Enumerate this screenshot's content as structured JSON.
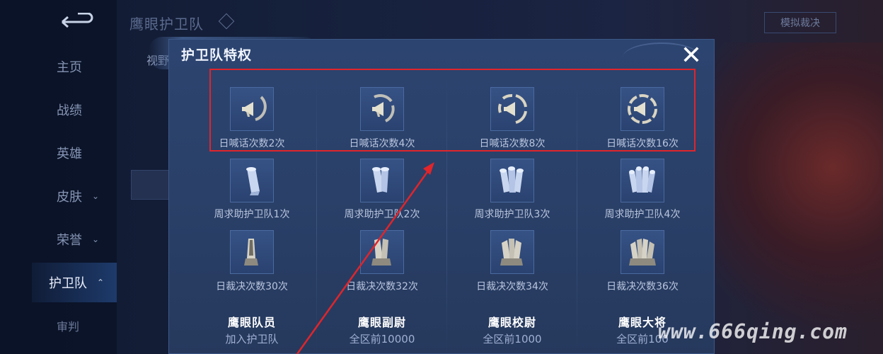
{
  "page": {
    "title": "鹰眼护卫队",
    "sim_button": "模拟裁决",
    "under_tab": "视野"
  },
  "sidebar": {
    "items": [
      {
        "label": "主页",
        "chevron": ""
      },
      {
        "label": "战绩",
        "chevron": ""
      },
      {
        "label": "英雄",
        "chevron": ""
      },
      {
        "label": "皮肤",
        "chevron": "⌄"
      },
      {
        "label": "荣誉",
        "chevron": "⌄"
      },
      {
        "label": "护卫队",
        "chevron": "⌃"
      }
    ],
    "sub_item": "审判"
  },
  "modal": {
    "title": "护卫队特权",
    "close_glyph": "✕",
    "rows": [
      {
        "type": "shout",
        "labels": [
          "日喊话次数2次",
          "日喊话次数4次",
          "日喊话次数8次",
          "日喊话次数16次"
        ]
      },
      {
        "type": "scroll",
        "labels": [
          "周求助护卫队1次",
          "周求助护卫队2次",
          "周求助护卫队3次",
          "周求助护卫队4次"
        ]
      },
      {
        "type": "judge",
        "labels": [
          "日裁决次数30次",
          "日裁决次数32次",
          "日裁决次数34次",
          "日裁决次数36次"
        ]
      }
    ],
    "ranks": [
      {
        "title": "鹰眼队员",
        "sub": "加入护卫队"
      },
      {
        "title": "鹰眼副尉",
        "sub": "全区前10000"
      },
      {
        "title": "鹰眼校尉",
        "sub": "全区前1000"
      },
      {
        "title": "鹰眼大将",
        "sub": "全区前100"
      }
    ]
  },
  "annotation": {
    "highlight_color": "#e0252b"
  },
  "watermark": "www.666qing.com"
}
